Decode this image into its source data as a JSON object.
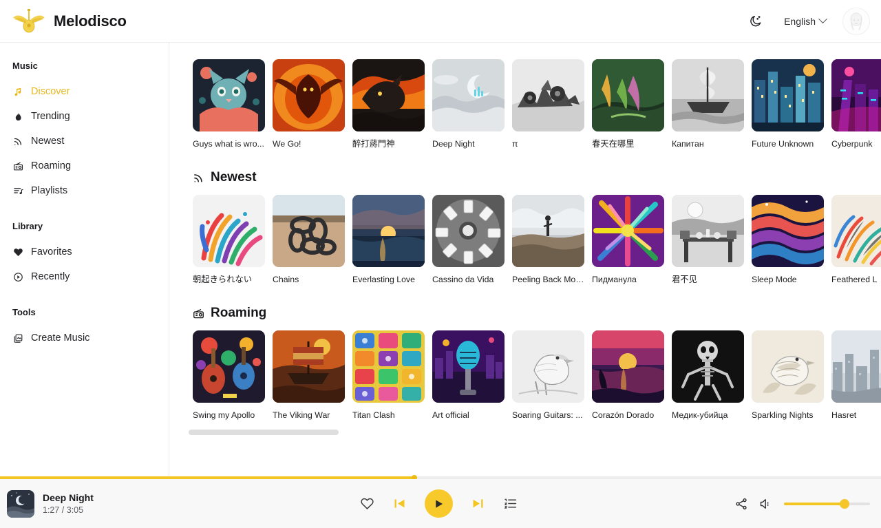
{
  "header": {
    "brand": "Melodisco",
    "logo_icon": "winged-guitar-logo",
    "theme_toggle_icon": "moon-stars-icon",
    "language": "English",
    "language_chevron_icon": "chevron-down-icon",
    "avatar_icon": "user-avatar"
  },
  "sidebar": {
    "groups": [
      {
        "title": "Music",
        "items": [
          {
            "label": "Discover",
            "icon": "music-note-icon",
            "active": true
          },
          {
            "label": "Trending",
            "icon": "flame-icon",
            "active": false
          },
          {
            "label": "Newest",
            "icon": "rss-icon",
            "active": false
          },
          {
            "label": "Roaming",
            "icon": "radio-icon",
            "active": false
          },
          {
            "label": "Playlists",
            "icon": "playlist-icon",
            "active": false
          }
        ]
      },
      {
        "title": "Library",
        "items": [
          {
            "label": "Favorites",
            "icon": "heart-filled-icon",
            "active": false
          },
          {
            "label": "Recently",
            "icon": "clock-play-icon",
            "active": false
          }
        ]
      },
      {
        "title": "Tools",
        "items": [
          {
            "label": "Create Music",
            "icon": "create-image-icon",
            "active": false
          }
        ]
      }
    ]
  },
  "main": {
    "sections": [
      {
        "id": "discover",
        "title": "",
        "icon": "",
        "show_header": false,
        "has_scrollbar": false,
        "cards": [
          {
            "title": "Guys what is wro...",
            "art": "cat"
          },
          {
            "title": "We Go!",
            "art": "phoenix"
          },
          {
            "title": "醉打蔣門神",
            "art": "dragon"
          },
          {
            "title": "Deep Night",
            "art": "moon"
          },
          {
            "title": "π",
            "art": "wreck"
          },
          {
            "title": "春天在哪里",
            "art": "forest"
          },
          {
            "title": "Капитан",
            "art": "ship"
          },
          {
            "title": "Future Unknown",
            "art": "city"
          },
          {
            "title": "Cyberpunk",
            "art": "cyberpunk"
          }
        ]
      },
      {
        "id": "newest",
        "title": "Newest",
        "icon": "rss-icon",
        "show_header": true,
        "has_scrollbar": false,
        "cards": [
          {
            "title": "朝起きられない",
            "art": "paint"
          },
          {
            "title": "Chains",
            "art": "chains"
          },
          {
            "title": "Everlasting Love",
            "art": "sunset"
          },
          {
            "title": "Cassino da Vida",
            "art": "cards"
          },
          {
            "title": "Peeling Back Mor...",
            "art": "cliff"
          },
          {
            "title": "Пидманула",
            "art": "burst"
          },
          {
            "title": "君不见",
            "art": "dinner"
          },
          {
            "title": "Sleep Mode",
            "art": "waves"
          },
          {
            "title": "Feathered L",
            "art": "feathers"
          }
        ]
      },
      {
        "id": "roaming",
        "title": "Roaming",
        "icon": "radio-icon",
        "show_header": true,
        "has_scrollbar": true,
        "cards": [
          {
            "title": "Swing my Apollo",
            "art": "instruments"
          },
          {
            "title": "The Viking War",
            "art": "vikingship"
          },
          {
            "title": "Titan Clash",
            "art": "arcade"
          },
          {
            "title": "Art official",
            "art": "mic"
          },
          {
            "title": "Soaring Guitars: ...",
            "art": "bird"
          },
          {
            "title": "Corazón Dorado",
            "art": "beach"
          },
          {
            "title": "Медик-убийца",
            "art": "skeleton"
          },
          {
            "title": "Sparkling Nights",
            "art": "birdart"
          },
          {
            "title": "Hasret",
            "art": "skyline"
          }
        ]
      }
    ]
  },
  "player": {
    "track_title": "Deep Night",
    "time": "1:27 / 3:05",
    "progress_percent": 47,
    "volume_percent": 70,
    "favorite_icon": "heart-outline-icon",
    "prev_icon": "skip-back-icon",
    "play_icon": "play-icon",
    "next_icon": "skip-forward-icon",
    "queue_icon": "queue-list-icon",
    "share_icon": "share-icon",
    "volume_icon": "speaker-icon"
  },
  "colors": {
    "accent": "#f3c521",
    "accent_active": "#e8b71a",
    "text": "#1c1c1e",
    "bar_bg": "#f8f8f8"
  }
}
